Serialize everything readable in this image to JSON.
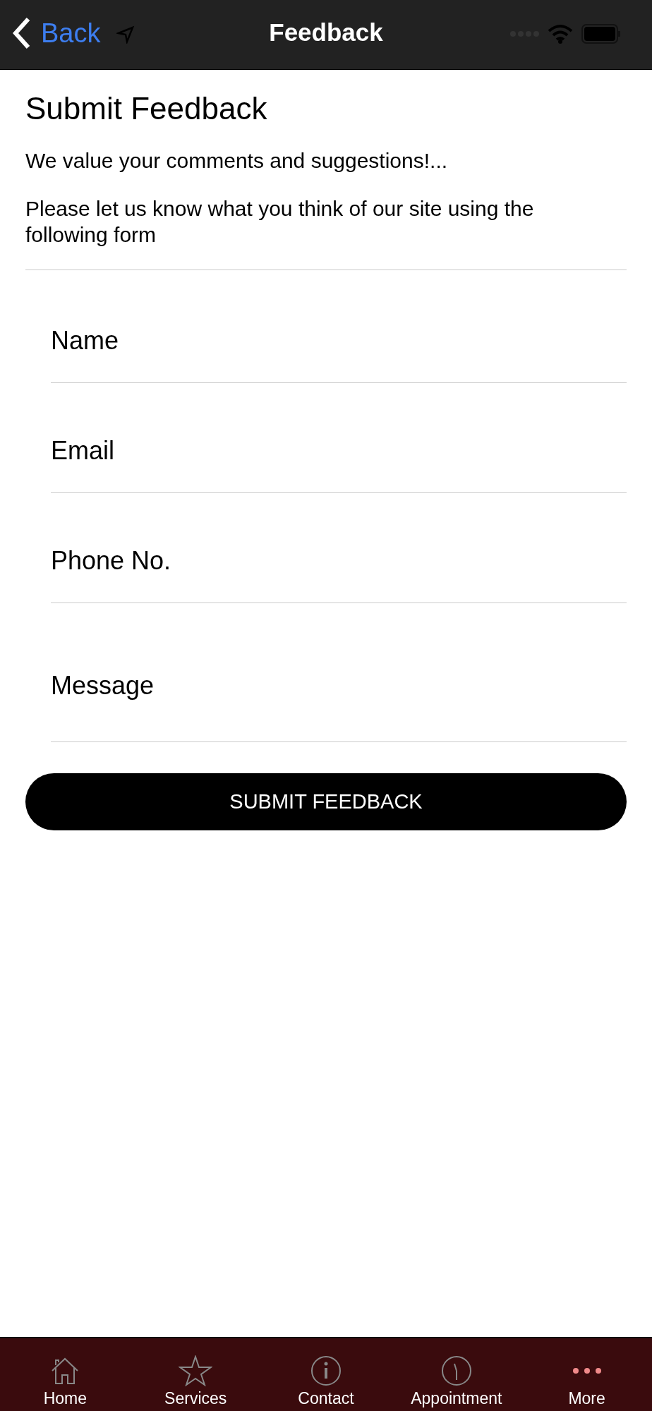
{
  "nav_bar": {
    "back_label": "Back",
    "title": "Feedback"
  },
  "heading": "Submit Feedback",
  "intro": [
    "We value your comments and suggestions!...",
    "Please let us know what you think of our site using the following form"
  ],
  "fields": [
    {
      "placeholder": "Name",
      "kind": "line"
    },
    {
      "placeholder": "Email",
      "kind": "line"
    },
    {
      "placeholder": "Phone No.",
      "kind": "line"
    },
    {
      "placeholder": "Message",
      "kind": "area"
    }
  ],
  "submit_button": "SUBMIT FEEDBACK",
  "tab_bar": [
    {
      "label": "Home",
      "kind": "home",
      "selected": false
    },
    {
      "label": "Services",
      "kind": "star",
      "selected": false
    },
    {
      "label": "Contact",
      "kind": "info",
      "selected": false
    },
    {
      "label": "Appointment",
      "kind": "clock",
      "selected": false
    },
    {
      "label": "More",
      "kind": "more",
      "selected": true
    }
  ]
}
